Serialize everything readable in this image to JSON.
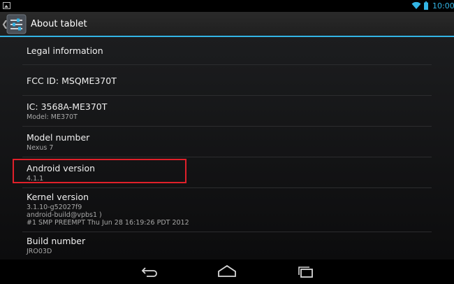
{
  "status_bar": {
    "time": "10:00",
    "notification_icon": "image-icon",
    "wifi_icon": "wifi-icon",
    "battery_icon": "battery-icon",
    "accent_color": "#33b5e5"
  },
  "action_bar": {
    "title": "About tablet",
    "app_icon": "settings-icon",
    "up_icon": "chevron-left-icon"
  },
  "list": {
    "items": [
      {
        "title": "Legal information",
        "lines": []
      },
      {
        "title": "FCC ID: MSQME370T",
        "lines": []
      },
      {
        "title": "IC: 3568A-ME370T",
        "lines": [
          "Model: ME370T"
        ]
      },
      {
        "title": "Model number",
        "lines": [
          "Nexus 7"
        ]
      },
      {
        "title": "Android version",
        "lines": [
          "4.1.1"
        ]
      },
      {
        "title": "Kernel version",
        "lines": [
          "3.1.10-g52027f9",
          "android-build@vpbs1 )",
          "#1 SMP PREEMPT Thu Jun 28 16:19:26 PDT 2012"
        ]
      },
      {
        "title": "Build number",
        "lines": [
          "JRO03D"
        ]
      }
    ],
    "highlight_color": "#e0202a"
  },
  "nav_bar": {
    "back_icon": "back-icon",
    "home_icon": "home-icon",
    "recents_icon": "recent-apps-icon"
  }
}
